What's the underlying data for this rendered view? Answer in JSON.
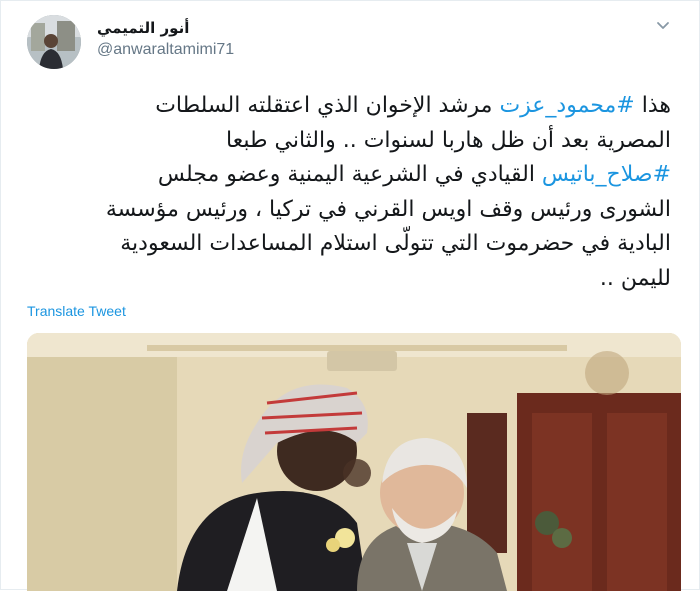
{
  "tweet": {
    "display_name": "أنور التميمي",
    "handle": "@anwaraltamimi71",
    "text_lines": [
      {
        "hashtag": "",
        "before": "هذا ",
        "tag": "#محمود_عزت",
        "after": " مرشد الإخوان الذي اعتقلته السلطات"
      },
      {
        "plain": "المصرية بعد أن ظل هاربا لسنوات .. والثاني طبعا"
      },
      {
        "before": "",
        "tag": "#صلاح_باتيس",
        "after": " القيادي في الشرعية اليمنية وعضو مجلس"
      },
      {
        "plain": "الشورى ورئيس وقف اويس القرني في تركيا ، ورئيس مؤسسة"
      },
      {
        "plain": "البادية في حضرموت التي تتولّى استلام المساعدات السعودية"
      },
      {
        "plain": "لليمن .."
      }
    ],
    "translate_label": "Translate Tweet"
  },
  "icons": {
    "more": "chevron-down-icon",
    "avatar": "user-avatar"
  },
  "colors": {
    "link": "#1b95e0",
    "text": "#14171a",
    "secondary": "#657786"
  }
}
